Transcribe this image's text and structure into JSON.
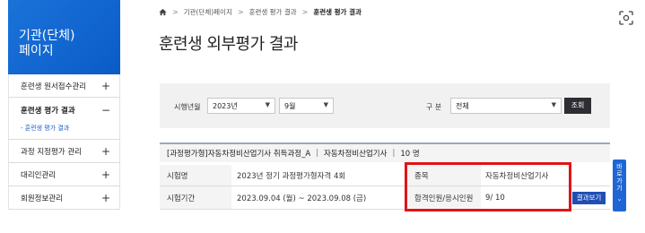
{
  "sidebar": {
    "title_line1": "기관(단체)",
    "title_line2": "페이지",
    "items": [
      {
        "label": "훈련생 원서접수관리",
        "sign": "+"
      },
      {
        "label": "훈련생 평가 결과",
        "sign": "−"
      },
      {
        "label": "과정 지정평가 관리",
        "sign": "+"
      },
      {
        "label": "대리인관리",
        "sign": "+"
      },
      {
        "label": "회원정보관리",
        "sign": "+"
      }
    ],
    "sub_item": "- 훈련생 평가 결과"
  },
  "breadcrumb": {
    "items": [
      "기관(단체)페이지",
      "훈련생 평가 결과"
    ],
    "current": "훈련생 평가 결과",
    "separator": ">"
  },
  "page_title": "훈련생 외부평가 결과",
  "search": {
    "exam_label": "시행년월",
    "year": "2023년",
    "month": "9월",
    "type_label": "구 분",
    "type_value": "전체",
    "button": "조회"
  },
  "course": {
    "name": "[과정평가형]자동차정비산업기사 취득과정_A",
    "subject": "자동차정비산업기사",
    "count": "10 명",
    "exam_name_label": "시험명",
    "exam_name": "2023년 정기 과정평가형자격 4회",
    "period_label": "시험기간",
    "period": "2023.09.04 (월) ~ 2023.09.08 (금)",
    "field_label": "종목",
    "field_value": "자동차정비산업기사",
    "pass_label": "합격인원/응시인원",
    "pass_value": "9/ 10",
    "result_button": "결과보기"
  },
  "quick_panel": {
    "label_1": "바",
    "label_2": "로",
    "label_3": "가",
    "label_4": "기",
    "arrow": "⌄"
  },
  "colors": {
    "sidebar_blue": "#0b5bc7",
    "highlight_red": "#e01414",
    "button_dark": "#2d2d33",
    "result_blue": "#1f4fb3"
  }
}
